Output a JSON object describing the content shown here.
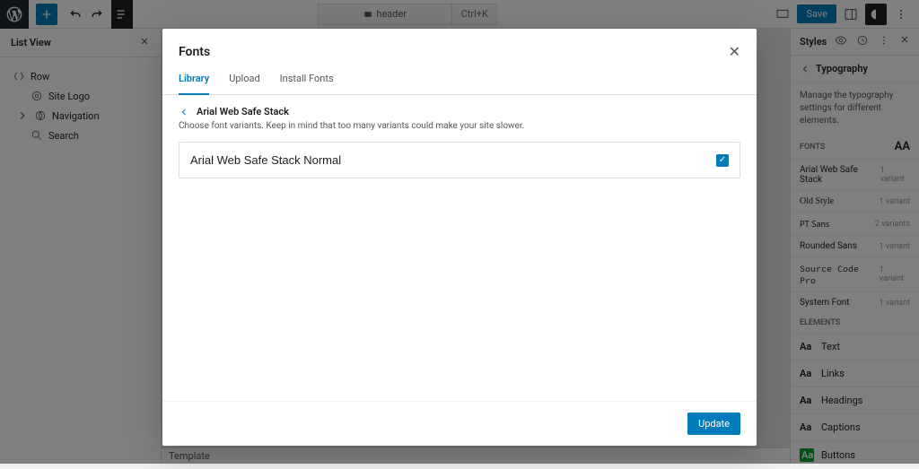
{
  "topbar": {
    "search": {
      "label": "header",
      "shortcut": "Ctrl+K"
    },
    "save_label": "Save"
  },
  "left_panel": {
    "title": "List View",
    "tree": {
      "row": "Row",
      "site_logo": "Site Logo",
      "navigation": "Navigation",
      "search": "Search"
    },
    "template_label": "Template"
  },
  "right_panel": {
    "title": "Styles",
    "breadcrumb": "Typography",
    "description": "Manage the typography settings for different elements.",
    "fonts_label": "FONTS",
    "fonts": [
      {
        "name": "Arial Web Safe Stack",
        "variants": "1 variant"
      },
      {
        "name": "Old Style",
        "variants": "1 variant"
      },
      {
        "name": "PT Sans",
        "variants": "2 variants"
      },
      {
        "name": "Rounded Sans",
        "variants": "1 variant"
      },
      {
        "name": "Source Code Pro",
        "variants": "1 variant"
      },
      {
        "name": "System Font",
        "variants": "1 variant"
      }
    ],
    "elements_label": "ELEMENTS",
    "elements": [
      "Text",
      "Links",
      "Headings",
      "Captions",
      "Buttons"
    ]
  },
  "modal": {
    "title": "Fonts",
    "tabs": {
      "library": "Library",
      "upload": "Upload",
      "install": "Install Fonts"
    },
    "font_name": "Arial Web Safe Stack",
    "hint": "Choose font variants. Keep in mind that too many variants could make your site slower.",
    "variant": "Arial Web Safe Stack Normal",
    "update_label": "Update"
  }
}
